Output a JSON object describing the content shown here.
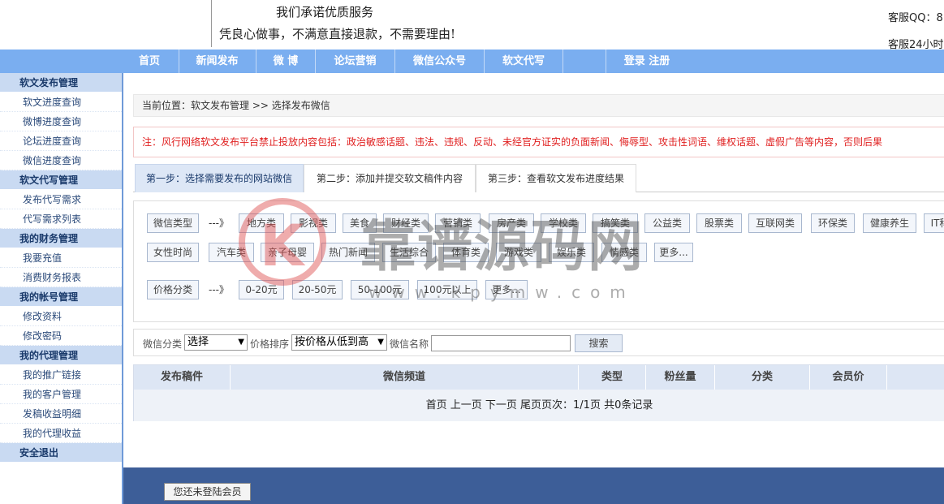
{
  "header": {
    "slogan_line1": "我们承诺优质服务",
    "slogan_line2": "凭良心做事，不满意直接退款，不需要理由!",
    "qq_label": "客服QQ：8",
    "hours_label": "客服24小时"
  },
  "nav": {
    "items": [
      "首页",
      "新闻发布",
      "微 博",
      "论坛营销",
      "微信公众号",
      "软文代写",
      "",
      "登录 注册"
    ]
  },
  "sidebar": {
    "groups": [
      {
        "title": "软文发布管理",
        "items": [
          "软文进度查询",
          "微博进度查询",
          "论坛进度查询",
          "微信进度查询"
        ]
      },
      {
        "title": "软文代写管理",
        "items": [
          "发布代写需求",
          "代写需求列表"
        ]
      },
      {
        "title": "我的财务管理",
        "items": [
          "我要充值",
          "消费财务报表"
        ]
      },
      {
        "title": "我的帐号管理",
        "items": [
          "修改资料",
          "修改密码"
        ]
      },
      {
        "title": "我的代理管理",
        "items": [
          "我的推广链接",
          "我的客户管理",
          "发稿收益明细",
          "我的代理收益"
        ]
      },
      {
        "title": "安全退出",
        "items": []
      }
    ]
  },
  "breadcrumb": "当前位置：软文发布管理 >> 选择发布微信",
  "notice": "注：风行网络软文发布平台禁止投放内容包括：政治敏感话题、违法、违规、反动、未经官方证实的负面新闻、侮辱型、攻击性词语、维权话题、虚假广告等内容，否则后果",
  "steps": [
    "第一步：选择需要发布的网站微信",
    "第二步：添加并提交软文稿件内容",
    "第三步：查看软文发布进度结果"
  ],
  "filters": {
    "type_label": "微信类型",
    "arrow": "---》",
    "types_row1": [
      "地方类",
      "影视类",
      "美食",
      "财经类",
      "营销类",
      "房产类",
      "学校类",
      "搞笑类",
      "公益类",
      "股票类",
      "互联网类",
      "环保类",
      "健康养生",
      "IT科"
    ],
    "types_row2": [
      "女性时尚",
      "汽车类",
      "亲子母婴",
      "热门新闻",
      "生活综合",
      "体育类",
      "游戏类",
      "娱乐类",
      "情感类",
      "更多..."
    ],
    "price_label": "价格分类",
    "prices": [
      "0-20元",
      "20-50元",
      "50-100元",
      "100元以上",
      "更多..."
    ]
  },
  "search": {
    "category_label": "微信分类",
    "category_value": "选择",
    "sort_label": "价格排序",
    "sort_value": "按价格从低到高",
    "name_label": "微信名称",
    "name_value": "",
    "button": "搜索"
  },
  "table": {
    "columns": [
      "发布稿件",
      "微信频道",
      "类型",
      "粉丝量",
      "分类",
      "会员价"
    ],
    "pager": "首页 上一页 下一页 尾页页次：1/1页 共0条记录"
  },
  "footer": {
    "login_prompt": "您还未登陆会员"
  },
  "watermark": {
    "logo_letter": "K",
    "text": "靠谱源码网",
    "url": "www.kpymw.com"
  }
}
